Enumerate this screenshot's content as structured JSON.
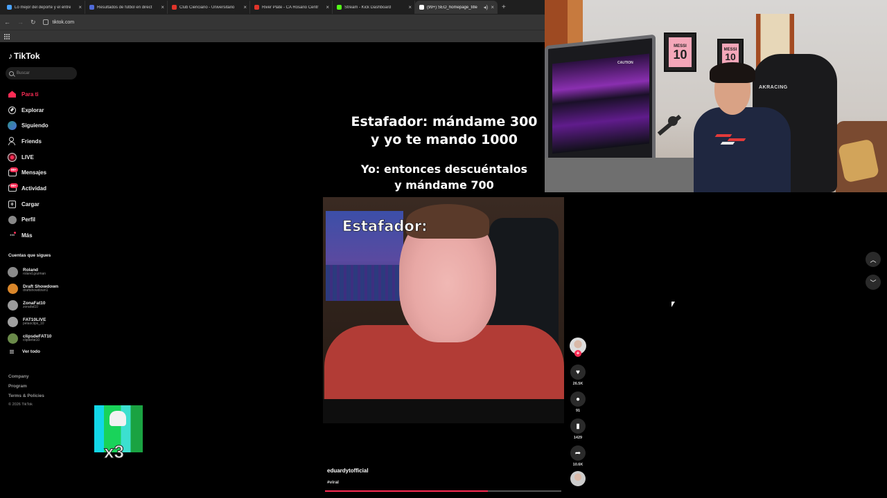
{
  "browser": {
    "tabs": [
      {
        "title": "Lo mejor del deporte y el entre",
        "color": "#4aa3ff",
        "active": false
      },
      {
        "title": "Resultados de fútbol en direct",
        "color": "#4f6ad8",
        "active": false
      },
      {
        "title": "Club Cienciano - Universitario",
        "color": "#e0342a",
        "active": false
      },
      {
        "title": "River Plate - CA Rosario Centr",
        "color": "#e0342a",
        "active": false
      },
      {
        "title": "Stream - Kick Dashboard",
        "color": "#53fc18",
        "active": false
      },
      {
        "title": "(99+) SEO_homepage_title",
        "color": "#ffffff",
        "active": true
      }
    ],
    "new_tab_symbol": "+",
    "url": "tiktok.com"
  },
  "sidebar": {
    "logo": "TikTok",
    "search_placeholder": "Buscar",
    "nav": [
      {
        "label": "Para ti",
        "icon": "home-icon",
        "active": true
      },
      {
        "label": "Explorar",
        "icon": "compass-icon"
      },
      {
        "label": "Siguiendo",
        "icon": "following-icon"
      },
      {
        "label": "Friends",
        "icon": "friends-icon"
      },
      {
        "label": "LIVE",
        "icon": "live-icon"
      },
      {
        "label": "Mensajes",
        "icon": "messages-icon",
        "badge": "99+"
      },
      {
        "label": "Actividad",
        "icon": "activity-icon",
        "badge": "99+"
      },
      {
        "label": "Cargar",
        "icon": "upload-icon"
      },
      {
        "label": "Perfil",
        "icon": "profile-icon"
      },
      {
        "label": "Más",
        "icon": "more-icon"
      }
    ],
    "following_title": "Cuentas que sigues",
    "following": [
      {
        "name": "Roland",
        "handle": "roland.gozman",
        "color": "#8a8a8a"
      },
      {
        "name": "Draft Showdown",
        "handle": "draftshowdown1",
        "color": "#d9862a"
      },
      {
        "name": "ZonaFat10",
        "handle": "zonafat10",
        "color": "#9a9a9a"
      },
      {
        "name": "FAT10LIVE",
        "handle": "pelaoclips_10",
        "color": "#a0a0a0"
      },
      {
        "name": "clipsdeFAT10",
        "handle": "clipdefat10",
        "color": "#6a8a4a"
      }
    ],
    "see_all": "Ver todo",
    "footer": {
      "links": [
        "Company",
        "Program",
        "Terms & Policies"
      ],
      "copyright": "© 2026 TikTok"
    }
  },
  "sticker": {
    "text": "x3"
  },
  "video": {
    "caption_line1": "Estafador: mándame 300",
    "caption_line2": "y yo te mando 1000",
    "caption_line3": "Yo: entonces descuéntalos",
    "caption_line4": "y mándame 700",
    "overlay_label": "Estafador:",
    "author": "eduardytofficial",
    "hashtag": "#viral",
    "progress_fraction": 0.69
  },
  "actions": {
    "likes": "26.5K",
    "comments": "91",
    "saves": "1429",
    "shares": "10.6K"
  },
  "webcam": {
    "jersey1_name": "MESSI",
    "jersey1_number": "10",
    "jersey2_name": "MESSI",
    "jersey2_number": "10",
    "pc_label": "CAUTION",
    "chair_brand": "AKRACING"
  }
}
